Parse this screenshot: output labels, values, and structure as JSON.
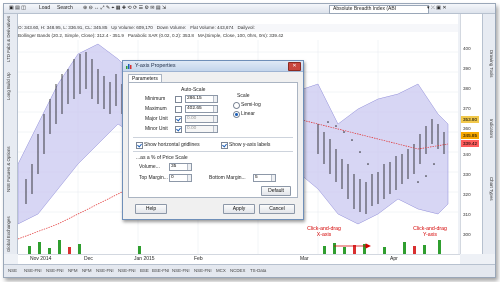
{
  "toolbar": {
    "load_label": "Load",
    "search_label": "Search",
    "indicator_select": "Absolute Breadth Index (ABI"
  },
  "info_bar": {
    "ohlc": "O: 343.60, H: 348.95, L: 336.91, CL: 345.85",
    "up_volume": "Up Volume: 609,170",
    "down_volume": "Down Volume:",
    "flat_volume": "Flat Volume: 443,674",
    "daily_vol": "Dailyvol:"
  },
  "info_bar2": {
    "bollinger": "Bollinger Bands (20.2, Simple, Close): 312.4 - 351.9",
    "parabolic": "Parabolic SAR (0.02, 0.2): 353.8",
    "ma": "MA(Simple, Close, 100, 0hrs, 0rs): 339.42"
  },
  "left_tabs": [
    "NSE Futures & Options",
    "Long Build Up",
    "LTD Fabs & Derivatives",
    "Global Exchanges"
  ],
  "right_tabs": [
    "Drawing Tools",
    "Indicators",
    "Chart Types"
  ],
  "y_axis": {
    "ticks": [
      "400",
      "390",
      "380",
      "370",
      "360",
      "350",
      "340",
      "330",
      "320",
      "310",
      "300"
    ],
    "markers": [
      {
        "text": "353.80",
        "color": "#f2c94c"
      },
      {
        "text": "345.85",
        "color": "#f7a800"
      },
      {
        "text": "339.42",
        "color": "#ff5c5c"
      }
    ]
  },
  "x_axis": {
    "ticks": [
      "Nov 2014",
      "Dec",
      "Jan 2015",
      "Feb",
      "Mar",
      "Apr"
    ]
  },
  "annotations": {
    "x_drag": "Click-and-drag\nX-axis",
    "y_drag": "Click-and-drag\nY-axis"
  },
  "bottom_tabs": [
    "NSE",
    "NSE-FNI",
    "NSE-FNI",
    "NFM",
    "NFM",
    "NSE-FNI",
    "NSE-FNI",
    "BSE",
    "BSE-FNI",
    "NSE-FNI",
    "NSE-FNI",
    "MCX",
    "NCDEX",
    "TS-Data"
  ],
  "colors": {
    "bollinger_fill": "#c9c8f0",
    "volume_bars": "#2f9e2f",
    "ma_line": "#e03030",
    "annotation": "#d40000"
  },
  "dialog": {
    "title": "Y-axis Properties",
    "tab_label": "Parameters",
    "auto_scale_label": "Auto-Scale",
    "scale_label": "Scale",
    "fields": [
      {
        "label": "Minimum",
        "value": "286.15",
        "disabled": false
      },
      {
        "label": "Maximum",
        "value": "402.65",
        "disabled": false
      },
      {
        "label": "Major Unit",
        "value": "0.00",
        "disabled": true
      },
      {
        "label": "Minor Unit",
        "value": "0.00",
        "disabled": true
      }
    ],
    "semi_log_label": "Semi-log",
    "linear_label": "Linear",
    "horizontal_gridlines_label": "Show horizontal gridlines",
    "yaxis_labels_label": "Show y-axis labels",
    "price_scale_label": "...as a % of Price Scale",
    "volume_label": "Volume...",
    "volume_value": "35",
    "top_margin_label": "Top Margin...",
    "top_margin_value": "0",
    "bottom_margin_label": "Bottom Margin...",
    "bottom_margin_value": "5",
    "default_label": "Default",
    "help_label": "Help",
    "apply_label": "Apply",
    "cancel_label": "Cancel"
  }
}
